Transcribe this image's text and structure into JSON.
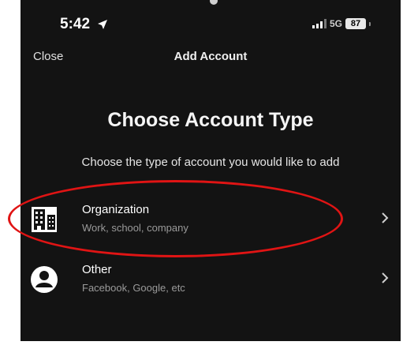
{
  "status_bar": {
    "time": "5:42",
    "network": "5G",
    "battery": "87"
  },
  "nav": {
    "close_label": "Close",
    "title": "Add Account"
  },
  "main": {
    "title": "Choose Account Type",
    "subtitle": "Choose the type of account you would like to add"
  },
  "options": [
    {
      "title": "Organization",
      "subtitle": "Work, school, company",
      "icon": "building-icon"
    },
    {
      "title": "Other",
      "subtitle": "Facebook, Google, etc",
      "icon": "person-icon"
    }
  ],
  "colors": {
    "background": "#131313",
    "annotation": "#e01414",
    "secondary_text": "#9a9a9a"
  }
}
